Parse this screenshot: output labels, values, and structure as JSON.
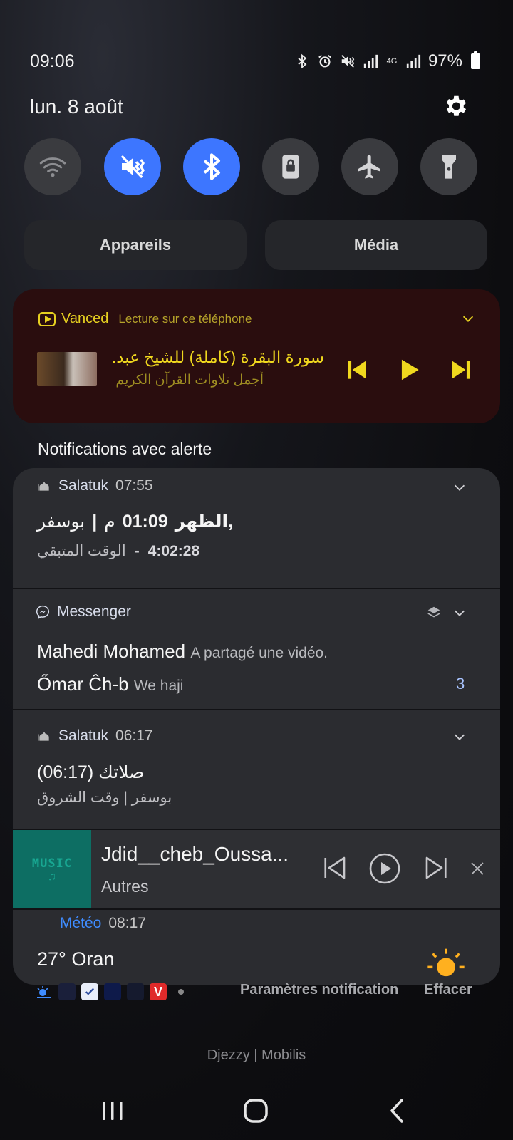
{
  "status": {
    "time": "09:06",
    "network": "4G",
    "battery_text": "97%"
  },
  "date": "lun. 8 août",
  "quick_toggles": [
    {
      "name": "wifi",
      "state": "off"
    },
    {
      "name": "sound-mute",
      "state": "on"
    },
    {
      "name": "bluetooth",
      "state": "on"
    },
    {
      "name": "screen-lock",
      "state": "off"
    },
    {
      "name": "airplane",
      "state": "off"
    },
    {
      "name": "flashlight",
      "state": "off"
    }
  ],
  "panel_buttons": {
    "devices": "Appareils",
    "media": "Média"
  },
  "media": {
    "app": "Vanced",
    "subtitle": "Lecture sur ce téléphone",
    "title": "سورة البقرة (كاملة) للشيخ عبد...",
    "artist": "أجمل تلاوات القرآن الكريم",
    "accent": "#e6d020"
  },
  "section_label": "Notifications avec alerte",
  "notifications": [
    {
      "app": "Salatuk",
      "time": "07:55",
      "line1_prayer": "الظهر,",
      "line1_time": "01:09",
      "line1_ampm": "م",
      "line1_city": "بوسفر",
      "line2_label": "الوقت المتبقي",
      "line2_value": "4:02:28"
    },
    {
      "app": "Messenger",
      "rows": [
        {
          "sender": "Mahedi Mohamed",
          "message": "A partagé une vidéo."
        },
        {
          "sender": "Őmar Ĉh-b",
          "message": "We haji",
          "count": "3"
        }
      ]
    },
    {
      "app": "Salatuk",
      "time": "06:17",
      "title": "صلاتك (06:17)",
      "text": "بوسفر | وقت الشروق"
    }
  ],
  "music_player": {
    "thumb_text": "MUSIC",
    "title": "Jdid__cheb_Oussa...",
    "subtitle": "Autres",
    "thumb_color": "#0d6e63"
  },
  "weather": {
    "app": "Météo",
    "time": "08:17",
    "text": "27° Oran"
  },
  "footer": {
    "settings": "Paramètres notification",
    "clear": "Effacer"
  },
  "carrier": "Djezzy | Mobilis"
}
